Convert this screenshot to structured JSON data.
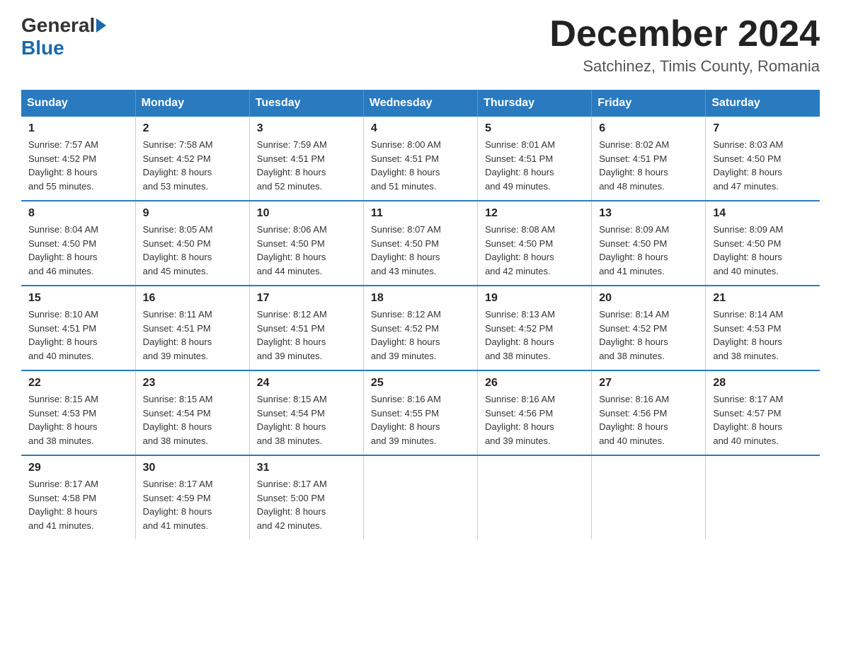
{
  "header": {
    "logo_general": "General",
    "logo_blue": "Blue",
    "month_year": "December 2024",
    "location": "Satchinez, Timis County, Romania"
  },
  "days_of_week": [
    "Sunday",
    "Monday",
    "Tuesday",
    "Wednesday",
    "Thursday",
    "Friday",
    "Saturday"
  ],
  "weeks": [
    [
      {
        "day": "1",
        "sunrise": "7:57 AM",
        "sunset": "4:52 PM",
        "daylight": "8 hours and 55 minutes."
      },
      {
        "day": "2",
        "sunrise": "7:58 AM",
        "sunset": "4:52 PM",
        "daylight": "8 hours and 53 minutes."
      },
      {
        "day": "3",
        "sunrise": "7:59 AM",
        "sunset": "4:51 PM",
        "daylight": "8 hours and 52 minutes."
      },
      {
        "day": "4",
        "sunrise": "8:00 AM",
        "sunset": "4:51 PM",
        "daylight": "8 hours and 51 minutes."
      },
      {
        "day": "5",
        "sunrise": "8:01 AM",
        "sunset": "4:51 PM",
        "daylight": "8 hours and 49 minutes."
      },
      {
        "day": "6",
        "sunrise": "8:02 AM",
        "sunset": "4:51 PM",
        "daylight": "8 hours and 48 minutes."
      },
      {
        "day": "7",
        "sunrise": "8:03 AM",
        "sunset": "4:50 PM",
        "daylight": "8 hours and 47 minutes."
      }
    ],
    [
      {
        "day": "8",
        "sunrise": "8:04 AM",
        "sunset": "4:50 PM",
        "daylight": "8 hours and 46 minutes."
      },
      {
        "day": "9",
        "sunrise": "8:05 AM",
        "sunset": "4:50 PM",
        "daylight": "8 hours and 45 minutes."
      },
      {
        "day": "10",
        "sunrise": "8:06 AM",
        "sunset": "4:50 PM",
        "daylight": "8 hours and 44 minutes."
      },
      {
        "day": "11",
        "sunrise": "8:07 AM",
        "sunset": "4:50 PM",
        "daylight": "8 hours and 43 minutes."
      },
      {
        "day": "12",
        "sunrise": "8:08 AM",
        "sunset": "4:50 PM",
        "daylight": "8 hours and 42 minutes."
      },
      {
        "day": "13",
        "sunrise": "8:09 AM",
        "sunset": "4:50 PM",
        "daylight": "8 hours and 41 minutes."
      },
      {
        "day": "14",
        "sunrise": "8:09 AM",
        "sunset": "4:50 PM",
        "daylight": "8 hours and 40 minutes."
      }
    ],
    [
      {
        "day": "15",
        "sunrise": "8:10 AM",
        "sunset": "4:51 PM",
        "daylight": "8 hours and 40 minutes."
      },
      {
        "day": "16",
        "sunrise": "8:11 AM",
        "sunset": "4:51 PM",
        "daylight": "8 hours and 39 minutes."
      },
      {
        "day": "17",
        "sunrise": "8:12 AM",
        "sunset": "4:51 PM",
        "daylight": "8 hours and 39 minutes."
      },
      {
        "day": "18",
        "sunrise": "8:12 AM",
        "sunset": "4:52 PM",
        "daylight": "8 hours and 39 minutes."
      },
      {
        "day": "19",
        "sunrise": "8:13 AM",
        "sunset": "4:52 PM",
        "daylight": "8 hours and 38 minutes."
      },
      {
        "day": "20",
        "sunrise": "8:14 AM",
        "sunset": "4:52 PM",
        "daylight": "8 hours and 38 minutes."
      },
      {
        "day": "21",
        "sunrise": "8:14 AM",
        "sunset": "4:53 PM",
        "daylight": "8 hours and 38 minutes."
      }
    ],
    [
      {
        "day": "22",
        "sunrise": "8:15 AM",
        "sunset": "4:53 PM",
        "daylight": "8 hours and 38 minutes."
      },
      {
        "day": "23",
        "sunrise": "8:15 AM",
        "sunset": "4:54 PM",
        "daylight": "8 hours and 38 minutes."
      },
      {
        "day": "24",
        "sunrise": "8:15 AM",
        "sunset": "4:54 PM",
        "daylight": "8 hours and 38 minutes."
      },
      {
        "day": "25",
        "sunrise": "8:16 AM",
        "sunset": "4:55 PM",
        "daylight": "8 hours and 39 minutes."
      },
      {
        "day": "26",
        "sunrise": "8:16 AM",
        "sunset": "4:56 PM",
        "daylight": "8 hours and 39 minutes."
      },
      {
        "day": "27",
        "sunrise": "8:16 AM",
        "sunset": "4:56 PM",
        "daylight": "8 hours and 40 minutes."
      },
      {
        "day": "28",
        "sunrise": "8:17 AM",
        "sunset": "4:57 PM",
        "daylight": "8 hours and 40 minutes."
      }
    ],
    [
      {
        "day": "29",
        "sunrise": "8:17 AM",
        "sunset": "4:58 PM",
        "daylight": "8 hours and 41 minutes."
      },
      {
        "day": "30",
        "sunrise": "8:17 AM",
        "sunset": "4:59 PM",
        "daylight": "8 hours and 41 minutes."
      },
      {
        "day": "31",
        "sunrise": "8:17 AM",
        "sunset": "5:00 PM",
        "daylight": "8 hours and 42 minutes."
      },
      null,
      null,
      null,
      null
    ]
  ],
  "labels": {
    "sunrise": "Sunrise:",
    "sunset": "Sunset:",
    "daylight": "Daylight:"
  }
}
